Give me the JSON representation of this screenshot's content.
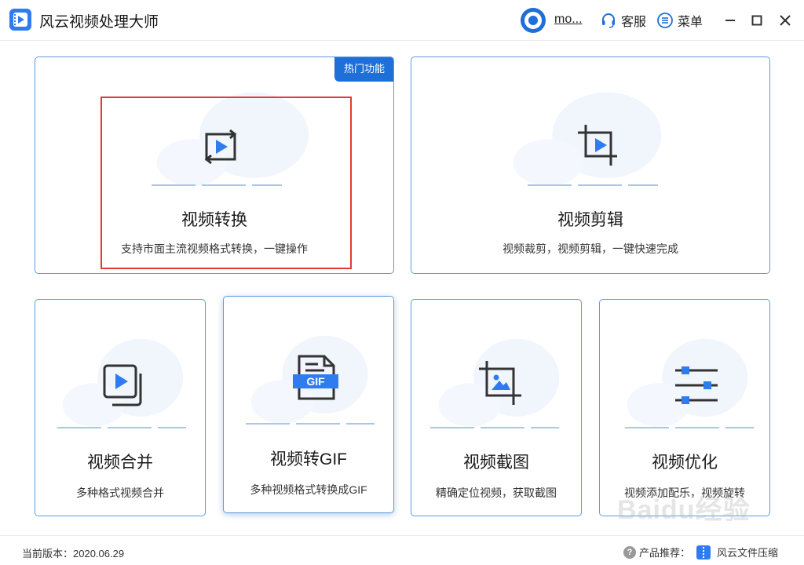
{
  "app": {
    "title": "风云视频处理大师"
  },
  "header": {
    "user_name": "mo...",
    "service_label": "客服",
    "menu_label": "菜单"
  },
  "cards": {
    "convert": {
      "title": "视频转换",
      "desc": "支持市面主流视频格式转换，一键操作",
      "badge": "热门功能"
    },
    "edit": {
      "title": "视频剪辑",
      "desc": "视频裁剪，视频剪辑，一键快速完成"
    },
    "merge": {
      "title": "视频合并",
      "desc": "多种格式视频合并"
    },
    "gif": {
      "title": "视频转GIF",
      "desc": "多种视频格式转换成GIF",
      "icon_text": "GIF"
    },
    "screenshot": {
      "title": "视频截图",
      "desc": "精确定位视频，获取截图"
    },
    "optimize": {
      "title": "视频优化",
      "desc": "视频添加配乐，视频旋转"
    }
  },
  "footer": {
    "version_label": "当前版本：2020.06.29",
    "promo_label": "产品推荐：",
    "promo_product": "风云文件压缩"
  },
  "watermark": "Baidu经验",
  "colors": {
    "accent": "#1f6fd8",
    "icon_blue": "#2f7cf0",
    "card_border": "#5b9be0",
    "highlight": "#e53935"
  },
  "icons": [
    "app-logo-icon",
    "user-avatar-icon",
    "headset-icon",
    "menu-list-icon",
    "minimize-icon",
    "maximize-icon",
    "close-icon",
    "convert-icon",
    "crop-icon",
    "merge-icon",
    "gif-file-icon",
    "screenshot-icon",
    "sliders-icon",
    "help-icon",
    "zip-icon"
  ]
}
